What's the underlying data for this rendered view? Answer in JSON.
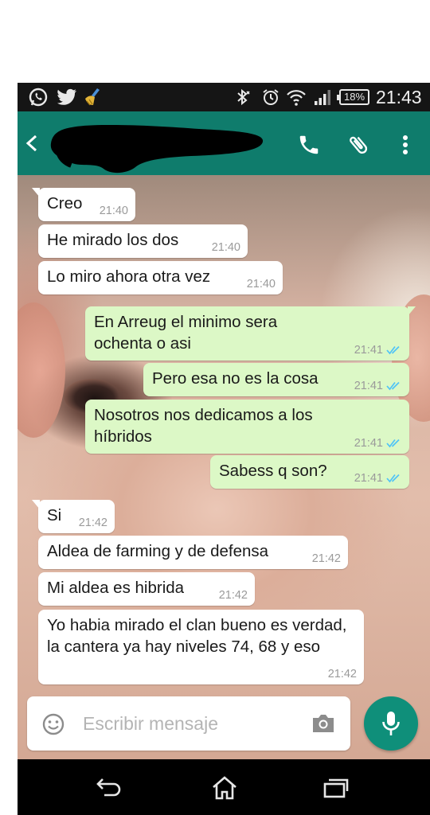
{
  "status_bar": {
    "battery_percent": "18%",
    "time": "21:43",
    "icons": [
      "whatsapp-icon",
      "twitter-icon",
      "clean-master-icon",
      "bluetooth-icon",
      "alarm-icon",
      "wifi-icon",
      "signal-icon",
      "battery-icon"
    ]
  },
  "toolbar": {
    "back_icon": "back-arrow-icon",
    "actions": [
      "phone-icon",
      "attach-icon",
      "more-vert-icon"
    ]
  },
  "messages": [
    {
      "dir": "in",
      "text": "Creo",
      "time": "21:40"
    },
    {
      "dir": "in",
      "text": "He mirado los dos",
      "time": "21:40"
    },
    {
      "dir": "in",
      "text": "Lo miro ahora otra vez",
      "time": "21:40"
    },
    {
      "dir": "out",
      "text": "En Arreug el minimo sera ochenta o asi",
      "time": "21:41"
    },
    {
      "dir": "out",
      "text": "Pero esa no es la cosa",
      "time": "21:41"
    },
    {
      "dir": "out",
      "text": "Nosotros nos dedicamos a los híbridos",
      "time": "21:41"
    },
    {
      "dir": "out",
      "text": "Sabess q son?",
      "time": "21:41"
    },
    {
      "dir": "in",
      "text": "Si",
      "time": "21:42"
    },
    {
      "dir": "in",
      "text": "Aldea de farming y de defensa",
      "time": "21:42"
    },
    {
      "dir": "in",
      "text": "Mi aldea es hibrida",
      "time": "21:42"
    },
    {
      "dir": "in",
      "text": "Yo habia mirado el clan bueno es verdad, la cantera ya hay niveles 74, 68 y eso",
      "time": "21:42"
    }
  ],
  "composer": {
    "placeholder": "Escribir mensaje",
    "emoji_icon": "emoji-icon",
    "camera_icon": "camera-icon",
    "mic_icon": "mic-icon"
  },
  "nav_bar": {
    "icons": [
      "nav-back-icon",
      "nav-home-icon",
      "nav-recents-icon"
    ]
  },
  "colors": {
    "toolbar": "#0f7c6c",
    "outgoing_bubble": "#dcf8c6",
    "incoming_bubble": "#ffffff",
    "read_ticks": "#4fc3f7",
    "mic_button": "#0f8f7a"
  }
}
